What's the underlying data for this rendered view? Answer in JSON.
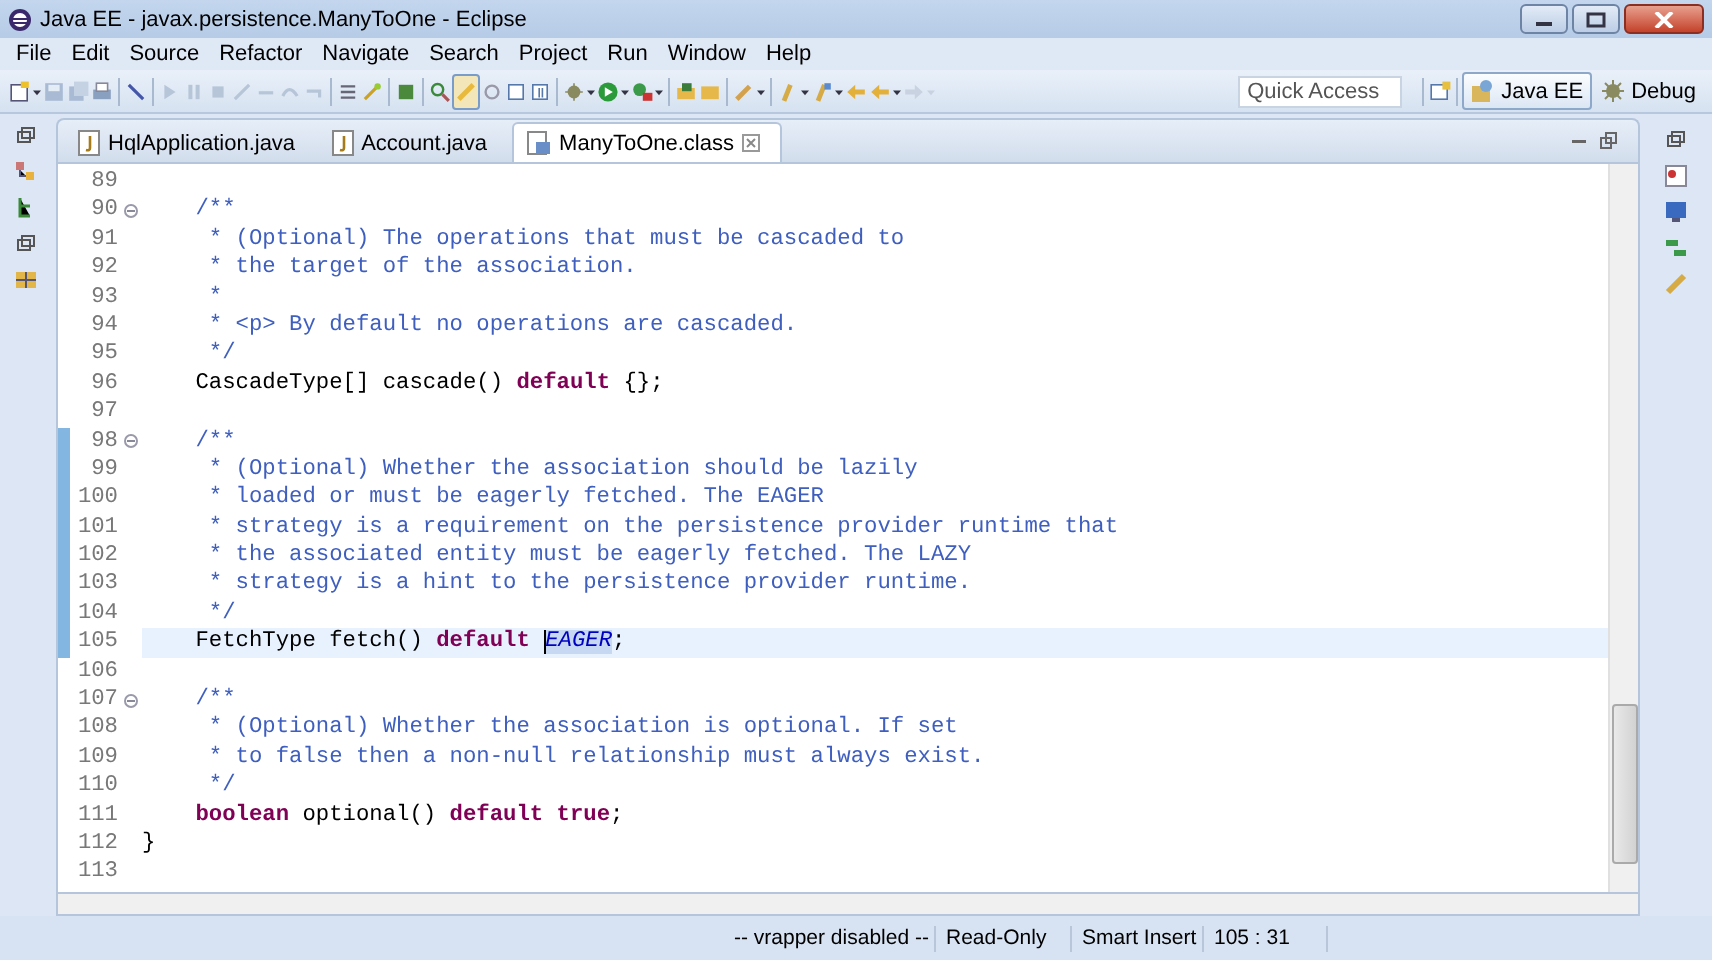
{
  "window": {
    "title": "Java EE - javax.persistence.ManyToOne - Eclipse"
  },
  "menu": [
    "File",
    "Edit",
    "Source",
    "Refactor",
    "Navigate",
    "Search",
    "Project",
    "Run",
    "Window",
    "Help"
  ],
  "quick_access": {
    "placeholder": "Quick Access"
  },
  "perspectives": [
    {
      "label": "Java EE",
      "selected": true
    },
    {
      "label": "Debug",
      "selected": false
    }
  ],
  "tabs": [
    {
      "label": "HqlApplication.java",
      "kind": "java",
      "selected": false,
      "closable": false
    },
    {
      "label": "Account.java",
      "kind": "java",
      "selected": false,
      "closable": false
    },
    {
      "label": "ManyToOne.class",
      "kind": "class",
      "selected": true,
      "closable": true
    }
  ],
  "editor": {
    "lines": [
      {
        "number": "89",
        "foldable": false,
        "changed": false,
        "current": false
      },
      {
        "number": "90",
        "foldable": true,
        "changed": false,
        "current": false,
        "tokens": [
          {
            "kind": "comment",
            "text": "    /**"
          }
        ]
      },
      {
        "number": "91",
        "foldable": false,
        "changed": false,
        "current": false,
        "tokens": [
          {
            "kind": "comment",
            "text": "     * (Optional) The operations that must be cascaded to"
          }
        ]
      },
      {
        "number": "92",
        "foldable": false,
        "changed": false,
        "current": false,
        "tokens": [
          {
            "kind": "comment",
            "text": "     * the target of the association."
          }
        ]
      },
      {
        "number": "93",
        "foldable": false,
        "changed": false,
        "current": false,
        "tokens": [
          {
            "kind": "comment",
            "text": "     *"
          }
        ]
      },
      {
        "number": "94",
        "foldable": false,
        "changed": false,
        "current": false,
        "tokens": [
          {
            "kind": "comment",
            "text": "     * <p> By default no operations are cascaded."
          }
        ]
      },
      {
        "number": "95",
        "foldable": false,
        "changed": false,
        "current": false,
        "tokens": [
          {
            "kind": "comment",
            "text": "     */"
          }
        ]
      },
      {
        "number": "96",
        "foldable": false,
        "changed": false,
        "current": false,
        "tokens": [
          {
            "kind": "plain",
            "text": "    CascadeType[] cascade() "
          },
          {
            "kind": "keyword",
            "text": "default"
          },
          {
            "kind": "plain",
            "text": " {};"
          }
        ]
      },
      {
        "number": "97",
        "foldable": false,
        "changed": false,
        "current": false
      },
      {
        "number": "98",
        "foldable": true,
        "changed": true,
        "current": false,
        "tokens": [
          {
            "kind": "comment",
            "text": "    /**"
          }
        ]
      },
      {
        "number": "99",
        "foldable": false,
        "changed": true,
        "current": false,
        "tokens": [
          {
            "kind": "comment",
            "text": "     * (Optional) Whether the association should be lazily"
          }
        ]
      },
      {
        "number": "100",
        "foldable": false,
        "changed": true,
        "current": false,
        "tokens": [
          {
            "kind": "comment",
            "text": "     * loaded or must be eagerly fetched. The EAGER"
          }
        ]
      },
      {
        "number": "101",
        "foldable": false,
        "changed": true,
        "current": false,
        "tokens": [
          {
            "kind": "comment",
            "text": "     * strategy is a requirement on the persistence provider runtime that"
          }
        ]
      },
      {
        "number": "102",
        "foldable": false,
        "changed": true,
        "current": false,
        "tokens": [
          {
            "kind": "comment",
            "text": "     * the associated entity must be eagerly fetched. The LAZY"
          }
        ]
      },
      {
        "number": "103",
        "foldable": false,
        "changed": true,
        "current": false,
        "tokens": [
          {
            "kind": "comment",
            "text": "     * strategy is a hint to the persistence provider runtime."
          }
        ]
      },
      {
        "number": "104",
        "foldable": false,
        "changed": true,
        "current": false,
        "tokens": [
          {
            "kind": "comment",
            "text": "     */"
          }
        ]
      },
      {
        "number": "105",
        "foldable": false,
        "changed": true,
        "current": true,
        "tokens": [
          {
            "kind": "plain",
            "text": "    FetchType fetch() "
          },
          {
            "kind": "keyword",
            "text": "default "
          },
          {
            "kind": "selection",
            "text": "EAGER"
          },
          {
            "kind": "plain",
            "text": ";"
          }
        ]
      },
      {
        "number": "106",
        "foldable": false,
        "changed": false,
        "current": false
      },
      {
        "number": "107",
        "foldable": true,
        "changed": false,
        "current": false,
        "tokens": [
          {
            "kind": "comment",
            "text": "    /**"
          }
        ]
      },
      {
        "number": "108",
        "foldable": false,
        "changed": false,
        "current": false,
        "tokens": [
          {
            "kind": "comment",
            "text": "     * (Optional) Whether the association is optional. If set"
          }
        ]
      },
      {
        "number": "109",
        "foldable": false,
        "changed": false,
        "current": false,
        "tokens": [
          {
            "kind": "comment",
            "text": "     * to false then a non-null relationship must always exist."
          }
        ]
      },
      {
        "number": "110",
        "foldable": false,
        "changed": false,
        "current": false,
        "tokens": [
          {
            "kind": "comment",
            "text": "     */"
          }
        ]
      },
      {
        "number": "111",
        "foldable": false,
        "changed": false,
        "current": false,
        "tokens": [
          {
            "kind": "keyword",
            "text": "    boolean"
          },
          {
            "kind": "plain",
            "text": " optional() "
          },
          {
            "kind": "keyword",
            "text": "default true"
          },
          {
            "kind": "plain",
            "text": ";"
          }
        ]
      },
      {
        "number": "112",
        "foldable": false,
        "changed": false,
        "current": false,
        "tokens": [
          {
            "kind": "plain",
            "text": "}"
          }
        ]
      },
      {
        "number": "113",
        "foldable": false,
        "changed": false,
        "current": false
      }
    ]
  },
  "status_bar": [
    "-- vrapper disabled --",
    "Read-Only",
    "Smart Insert",
    "105 : 31"
  ]
}
